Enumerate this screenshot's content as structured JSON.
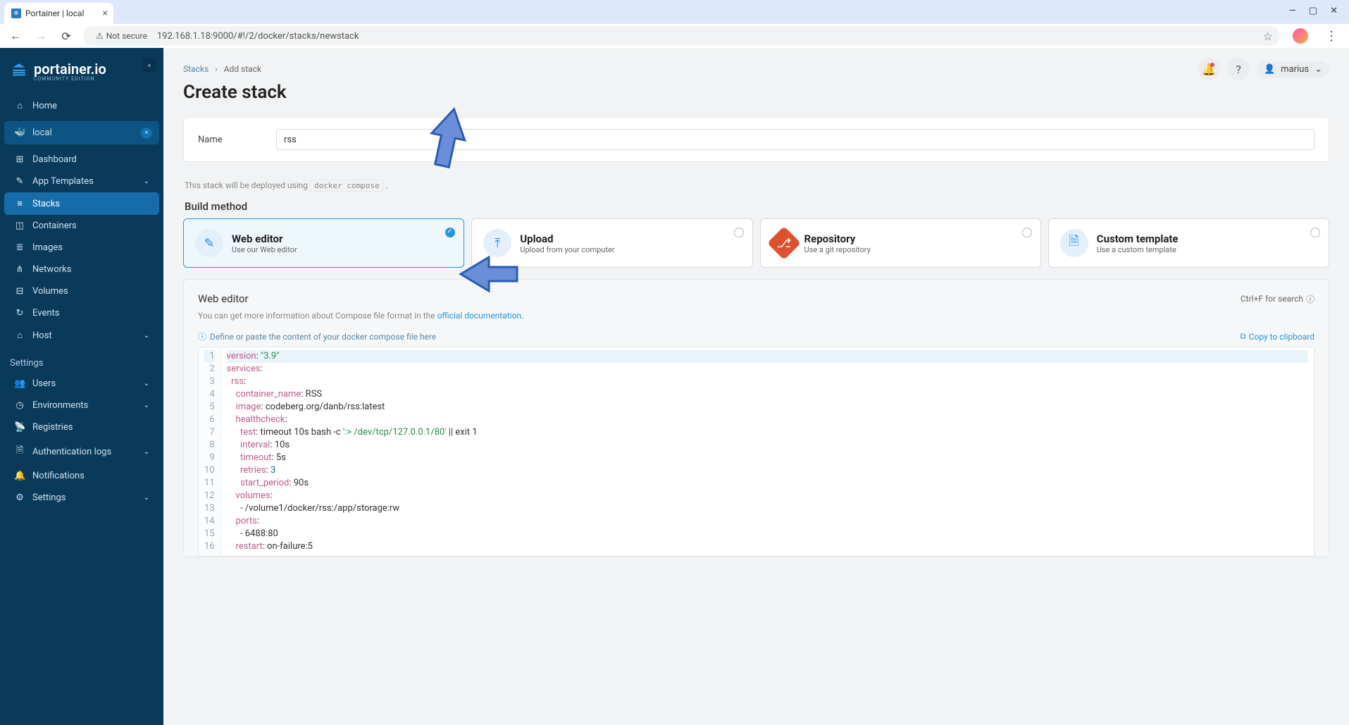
{
  "browser": {
    "tab_title": "Portainer | local",
    "url": "192.168.1.18:9000/#!/2/docker/stacks/newstack",
    "not_secure": "Not secure"
  },
  "sidebar": {
    "brand": "portainer.io",
    "brand_sub": "COMMUNITY EDITION",
    "home": "Home",
    "env": "local",
    "items": [
      {
        "icon": "⊞",
        "label": "Dashboard"
      },
      {
        "icon": "✎",
        "label": "App Templates",
        "chev": true
      },
      {
        "icon": "≡",
        "label": "Stacks",
        "active": true
      },
      {
        "icon": "◫",
        "label": "Containers"
      },
      {
        "icon": "≣",
        "label": "Images"
      },
      {
        "icon": "⋔",
        "label": "Networks"
      },
      {
        "icon": "⊟",
        "label": "Volumes"
      },
      {
        "icon": "↻",
        "label": "Events"
      },
      {
        "icon": "⌂",
        "label": "Host",
        "chev": true
      }
    ],
    "settings_heading": "Settings",
    "settings": [
      {
        "icon": "👥",
        "label": "Users",
        "chev": true
      },
      {
        "icon": "◷",
        "label": "Environments",
        "chev": true
      },
      {
        "icon": "📡",
        "label": "Registries"
      },
      {
        "icon": "🗎",
        "label": "Authentication logs",
        "chev": true
      },
      {
        "icon": "🔔",
        "label": "Notifications"
      },
      {
        "icon": "⚙",
        "label": "Settings",
        "chev": true
      }
    ]
  },
  "breadcrumb": {
    "root": "Stacks",
    "leaf": "Add stack"
  },
  "page_title": "Create stack",
  "user": "marius",
  "form": {
    "name_label": "Name",
    "name_value": "rss",
    "helper_pre": "This stack will be deployed using ",
    "helper_code": "docker compose",
    "helper_post": "."
  },
  "build_method_title": "Build method",
  "methods": [
    {
      "title": "Web editor",
      "sub": "Use our Web editor",
      "selected": true,
      "icon": "edit"
    },
    {
      "title": "Upload",
      "sub": "Upload from your computer",
      "icon": "upload"
    },
    {
      "title": "Repository",
      "sub": "Use a git repository",
      "icon": "git"
    },
    {
      "title": "Custom template",
      "sub": "Use a custom template",
      "icon": "template"
    }
  ],
  "editor": {
    "title": "Web editor",
    "search_hint": "Ctrl+F for search",
    "note_pre": "You can get more information about Compose file format in the ",
    "note_link": "official documentation",
    "note_post": ".",
    "placeholder": "Define or paste the content of your docker compose file here",
    "copy": "Copy to clipboard"
  },
  "code": {
    "lines": [
      {
        "n": 1,
        "hl": true,
        "tokens": [
          {
            "c": "tok-key",
            "t": "version"
          },
          {
            "c": "tok-plain",
            "t": ": "
          },
          {
            "c": "tok-str",
            "t": "\"3.9\""
          }
        ]
      },
      {
        "n": 2,
        "tokens": [
          {
            "c": "tok-key",
            "t": "services"
          },
          {
            "c": "tok-plain",
            "t": ":"
          }
        ]
      },
      {
        "n": 3,
        "tokens": [
          {
            "c": "tok-plain",
            "t": "  "
          },
          {
            "c": "tok-key",
            "t": "rss"
          },
          {
            "c": "tok-plain",
            "t": ":"
          }
        ]
      },
      {
        "n": 4,
        "tokens": [
          {
            "c": "tok-plain",
            "t": "    "
          },
          {
            "c": "tok-key",
            "t": "container_name"
          },
          {
            "c": "tok-plain",
            "t": ": RSS"
          }
        ]
      },
      {
        "n": 5,
        "tokens": [
          {
            "c": "tok-plain",
            "t": "    "
          },
          {
            "c": "tok-key",
            "t": "image"
          },
          {
            "c": "tok-plain",
            "t": ": codeberg.org/danb/rss:latest"
          }
        ]
      },
      {
        "n": 6,
        "tokens": [
          {
            "c": "tok-plain",
            "t": "    "
          },
          {
            "c": "tok-key",
            "t": "healthcheck"
          },
          {
            "c": "tok-plain",
            "t": ":"
          }
        ]
      },
      {
        "n": 7,
        "tokens": [
          {
            "c": "tok-plain",
            "t": "      "
          },
          {
            "c": "tok-key",
            "t": "test"
          },
          {
            "c": "tok-plain",
            "t": ": timeout 10s bash -c "
          },
          {
            "c": "tok-str",
            "t": "':> /dev/tcp/127.0.0.1/80'"
          },
          {
            "c": "tok-plain",
            "t": " || exit 1"
          }
        ]
      },
      {
        "n": 8,
        "tokens": [
          {
            "c": "tok-plain",
            "t": "      "
          },
          {
            "c": "tok-key",
            "t": "interval"
          },
          {
            "c": "tok-plain",
            "t": ": 10s"
          }
        ]
      },
      {
        "n": 9,
        "tokens": [
          {
            "c": "tok-plain",
            "t": "      "
          },
          {
            "c": "tok-key",
            "t": "timeout"
          },
          {
            "c": "tok-plain",
            "t": ": 5s"
          }
        ]
      },
      {
        "n": 10,
        "tokens": [
          {
            "c": "tok-plain",
            "t": "      "
          },
          {
            "c": "tok-key",
            "t": "retries"
          },
          {
            "c": "tok-plain",
            "t": ": "
          },
          {
            "c": "tok-num",
            "t": "3"
          }
        ]
      },
      {
        "n": 11,
        "tokens": [
          {
            "c": "tok-plain",
            "t": "      "
          },
          {
            "c": "tok-key",
            "t": "start_period"
          },
          {
            "c": "tok-plain",
            "t": ": 90s"
          }
        ]
      },
      {
        "n": 12,
        "tokens": [
          {
            "c": "tok-plain",
            "t": "    "
          },
          {
            "c": "tok-key",
            "t": "volumes"
          },
          {
            "c": "tok-plain",
            "t": ":"
          }
        ]
      },
      {
        "n": 13,
        "tokens": [
          {
            "c": "tok-plain",
            "t": "      - /volume1/docker/rss:/app/storage:rw"
          }
        ]
      },
      {
        "n": 14,
        "tokens": [
          {
            "c": "tok-plain",
            "t": "    "
          },
          {
            "c": "tok-key",
            "t": "ports"
          },
          {
            "c": "tok-plain",
            "t": ":"
          }
        ]
      },
      {
        "n": 15,
        "tokens": [
          {
            "c": "tok-plain",
            "t": "      - 6488:80"
          }
        ]
      },
      {
        "n": 16,
        "tokens": [
          {
            "c": "tok-plain",
            "t": "    "
          },
          {
            "c": "tok-key",
            "t": "restart"
          },
          {
            "c": "tok-plain",
            "t": ": on-failure:5"
          }
        ]
      }
    ]
  }
}
